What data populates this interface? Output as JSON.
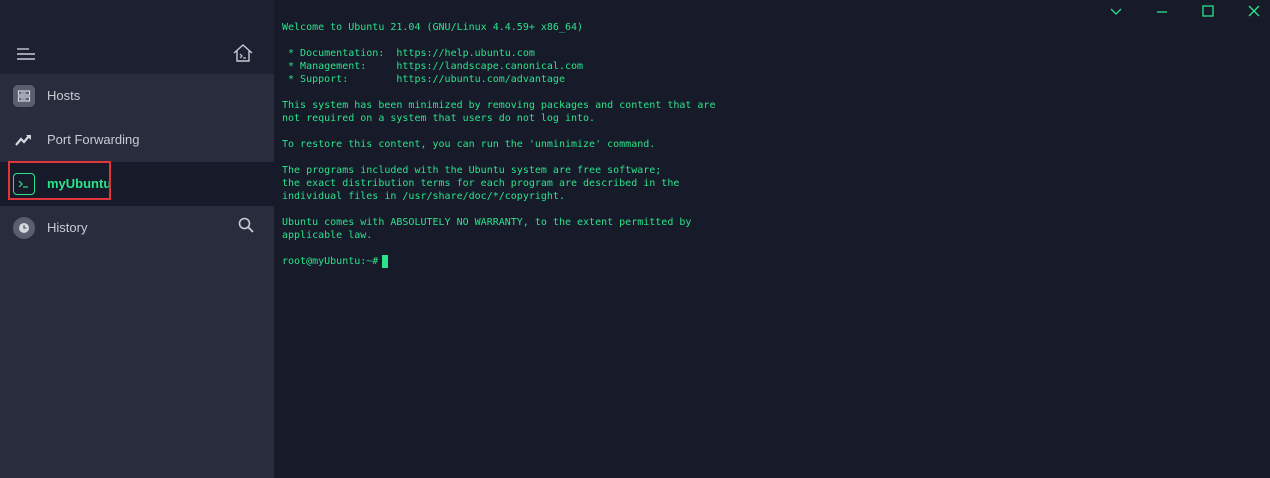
{
  "colors": {
    "accent": "#2be38a",
    "highlight": "#e0353b",
    "sidebar_bg": "#292c3c",
    "terminal_bg": "#161a29"
  },
  "sidebar": {
    "items": [
      {
        "label": "Hosts",
        "icon": "server-icon"
      },
      {
        "label": "Port Forwarding",
        "icon": "port-forward-icon"
      },
      {
        "label": "myUbuntu",
        "icon": "terminal-icon"
      },
      {
        "label": "History",
        "icon": "clock-icon"
      }
    ]
  },
  "terminal": {
    "lines": [
      "Welcome to Ubuntu 21.04 (GNU/Linux 4.4.59+ x86_64)",
      "",
      " * Documentation:  https://help.ubuntu.com",
      " * Management:     https://landscape.canonical.com",
      " * Support:        https://ubuntu.com/advantage",
      "",
      "This system has been minimized by removing packages and content that are",
      "not required on a system that users do not log into.",
      "",
      "To restore this content, you can run the 'unminimize' command.",
      "",
      "The programs included with the Ubuntu system are free software;",
      "the exact distribution terms for each program are described in the",
      "individual files in /usr/share/doc/*/copyright.",
      "",
      "Ubuntu comes with ABSOLUTELY NO WARRANTY, to the extent permitted by",
      "applicable law."
    ],
    "prompt": "root@myUbuntu:~#"
  }
}
